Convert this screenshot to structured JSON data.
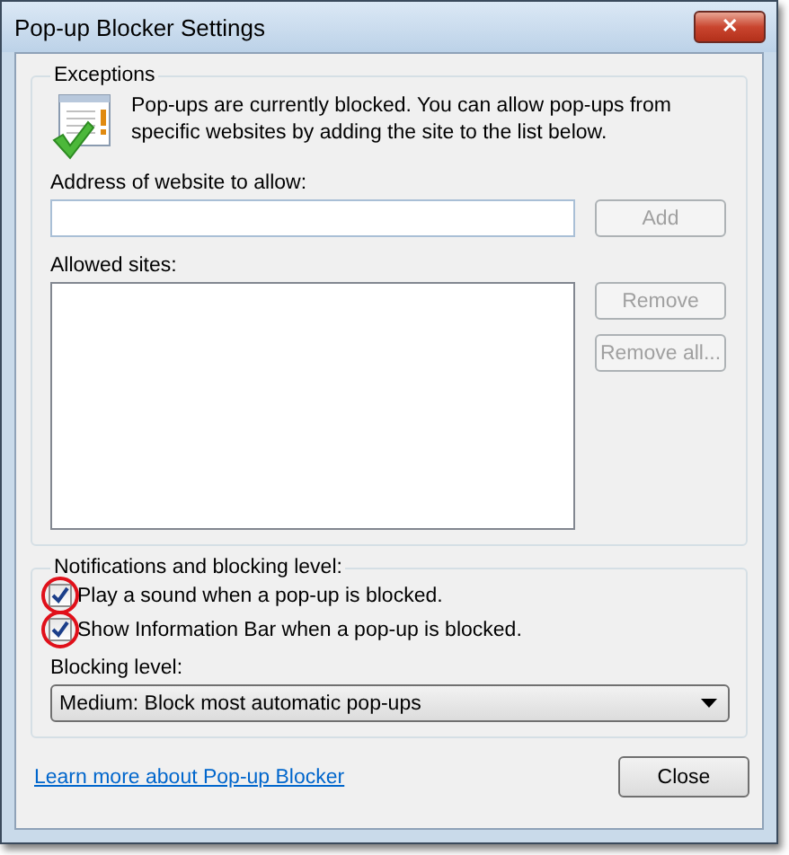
{
  "window": {
    "title": "Pop-up Blocker Settings",
    "close_glyph": "✕"
  },
  "exceptions": {
    "legend": "Exceptions",
    "message": "Pop-ups are currently blocked.  You can allow pop-ups from specific websites by adding the site to the list below.",
    "address_label": "Address of website to allow:",
    "add_button": {
      "label": "Add",
      "disabled": true
    },
    "allowed_label": "Allowed sites:",
    "remove_buttons": [
      {
        "label": "Remove",
        "disabled": true
      },
      {
        "label": "Remove all...",
        "disabled": true
      }
    ]
  },
  "notifications": {
    "legend": "Notifications and blocking level:",
    "options": [
      {
        "label": "Play a sound when a pop-up is blocked.",
        "checked": true,
        "circled": true
      },
      {
        "label": "Show Information Bar when a pop-up is blocked.",
        "checked": true,
        "circled": true
      }
    ],
    "blocking_label": "Blocking level:",
    "blocking_value": "Medium: Block most automatic pop-ups"
  },
  "footer": {
    "link": "Learn more about Pop-up Blocker",
    "close_button": "Close"
  }
}
